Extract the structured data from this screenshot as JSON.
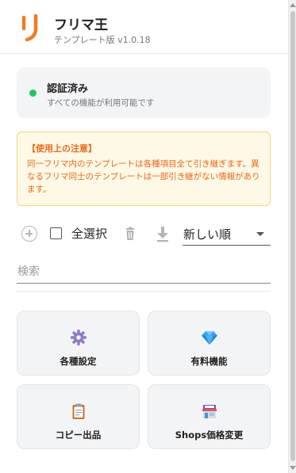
{
  "header": {
    "title": "フリマ王",
    "version": "テンプレート版 v1.0.18",
    "brand_color": "#f07c24"
  },
  "auth": {
    "status": "認証済み",
    "description": "すべての機能が利用可能です",
    "status_color": "#22c55e"
  },
  "notice": {
    "title": "【使用上の注意】",
    "body": "同一フリマ内のテンプレートは各種項目全て引き継ぎます。異なるフリマ同士のテンプレートは一部引き継がない情報があります。",
    "color": "#e86a1a"
  },
  "toolbar": {
    "add_icon": "add-circle-icon",
    "select_all_label": "全選択",
    "select_all_checked": false,
    "delete_icon": "trash-icon",
    "download_icon": "download-icon",
    "sort_value": "新しい順"
  },
  "search": {
    "placeholder": "検索",
    "value": ""
  },
  "tiles": [
    {
      "label": "各種設定",
      "icon": "gear-icon"
    },
    {
      "label": "有料機能",
      "icon": "gem-icon"
    },
    {
      "label": "コピー出品",
      "icon": "clipboard-icon"
    },
    {
      "label": "Shops価格変更",
      "icon": "shop-icon"
    }
  ]
}
